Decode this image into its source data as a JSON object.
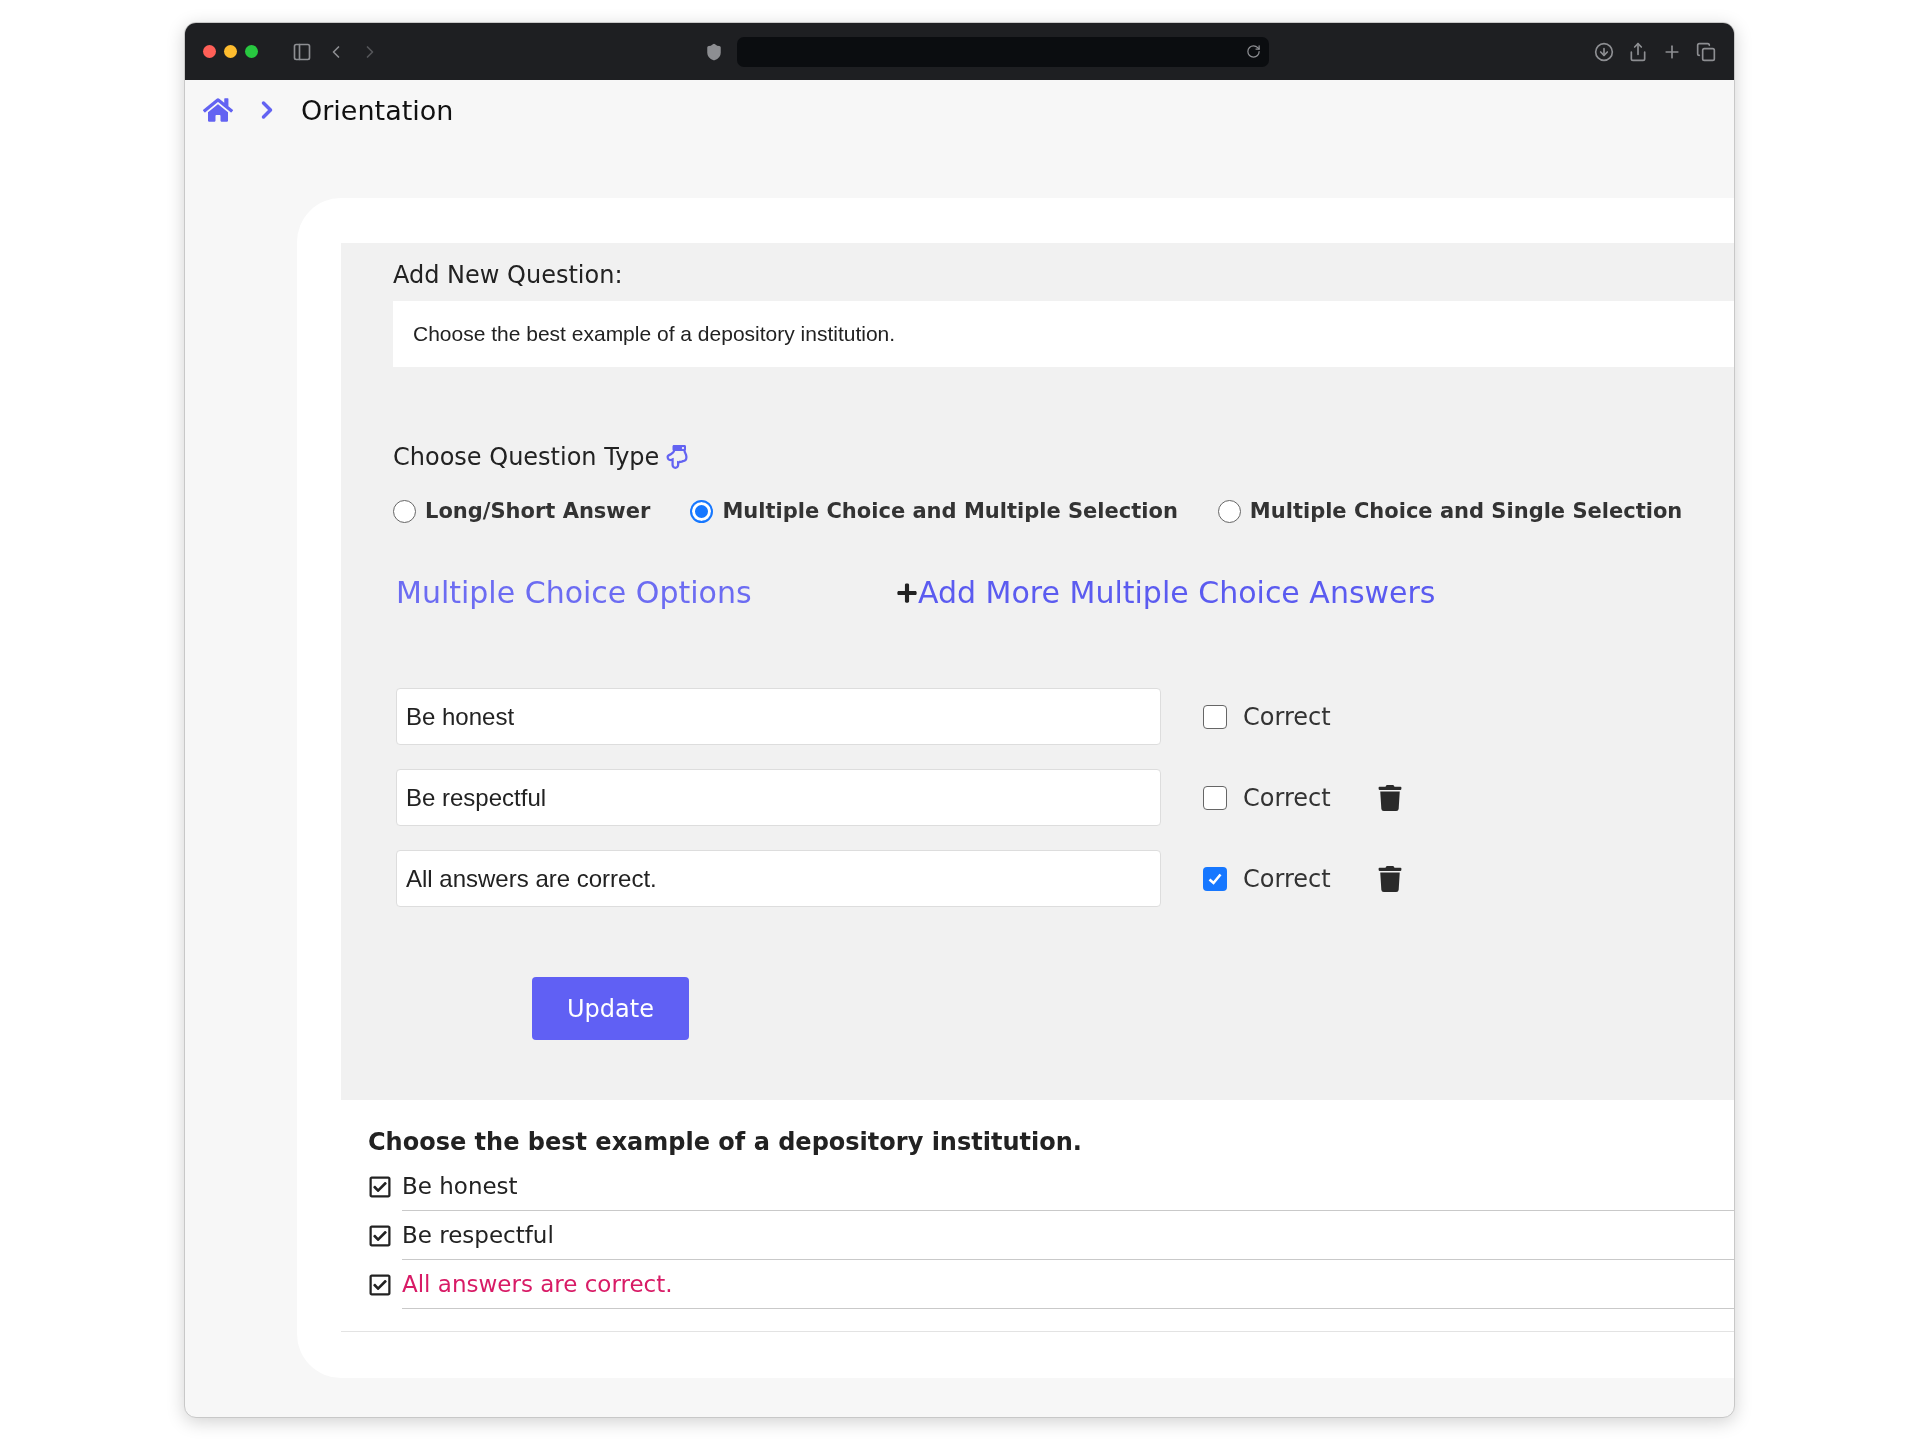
{
  "breadcrumb": {
    "current": "Orientation"
  },
  "form": {
    "question_label": "Add New Question:",
    "question_value": "Choose the best example of a depository institution.",
    "type_label": "Choose Question Type",
    "types": [
      {
        "label": "Long/Short Answer",
        "selected": false
      },
      {
        "label": "Multiple Choice and Multiple Selection",
        "selected": true
      },
      {
        "label": "Multiple Choice and Single Selection",
        "selected": false
      }
    ],
    "options_title": "Multiple Choice Options",
    "add_link": "Add More Multiple Choice Answers",
    "options": [
      {
        "value": "Be honest",
        "correct_label": "Correct",
        "checked": false,
        "deletable": false
      },
      {
        "value": "Be respectful",
        "correct_label": "Correct",
        "checked": false,
        "deletable": true
      },
      {
        "value": "All answers are correct.",
        "correct_label": "Correct",
        "checked": true,
        "deletable": true
      }
    ],
    "submit": "Update"
  },
  "preview": {
    "question": "Choose the best example of a depository institution.",
    "answers": [
      {
        "text": "Be honest",
        "correct": false
      },
      {
        "text": "Be respectful",
        "correct": false
      },
      {
        "text": "All answers are correct.",
        "correct": true
      }
    ]
  }
}
